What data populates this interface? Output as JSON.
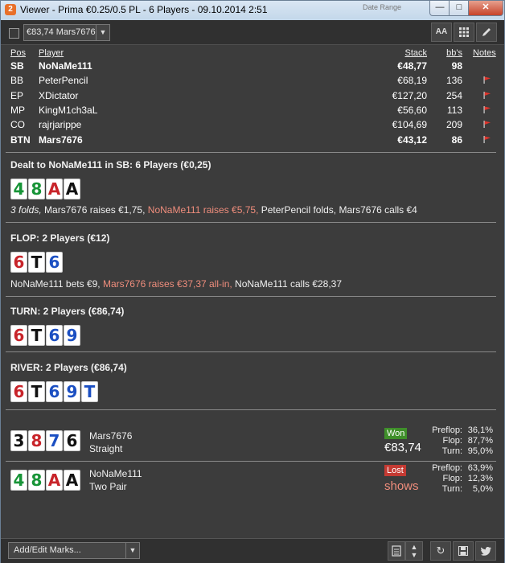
{
  "window": {
    "title": "Viewer - Prima €0.25/0.5 PL - 6 Players - 09.10.2014 2:51",
    "background_tab_text": "Date Range"
  },
  "toolbar": {
    "hand_selector_value": "€83,74 Mars7676",
    "font_button_label": "AA"
  },
  "players": {
    "headers": {
      "pos": "Pos",
      "player": "Player",
      "stack": "Stack",
      "bbs": "bb's",
      "notes": "Notes"
    },
    "rows": [
      {
        "pos": "SB",
        "name": "NoNaMe111",
        "stack": "€48,77",
        "bbs": "98",
        "flag": false,
        "bold": true
      },
      {
        "pos": "BB",
        "name": "PeterPencil",
        "stack": "€68,19",
        "bbs": "136",
        "flag": true,
        "bold": false
      },
      {
        "pos": "EP",
        "name": "XDictator",
        "stack": "€127,20",
        "bbs": "254",
        "flag": true,
        "bold": false
      },
      {
        "pos": "MP",
        "name": "KingM1ch3aL",
        "stack": "€56,60",
        "bbs": "113",
        "flag": true,
        "bold": false
      },
      {
        "pos": "CO",
        "name": "rajrjarippe",
        "stack": "€104,69",
        "bbs": "209",
        "flag": true,
        "bold": false
      },
      {
        "pos": "BTN",
        "name": "Mars7676",
        "stack": "€43,12",
        "bbs": "86",
        "flag": true,
        "bold": true
      }
    ],
    "flag_color": "#e0342b"
  },
  "preflop": {
    "title": "Dealt to NoNaMe111 in SB: 6 Players (€0,25)",
    "cards": [
      {
        "r": "4",
        "s": "c"
      },
      {
        "r": "8",
        "s": "c"
      },
      {
        "r": "A",
        "s": "h"
      },
      {
        "r": "A",
        "s": "s"
      }
    ],
    "actions": {
      "a1": "3 folds,",
      "a2": " Mars7676 raises €1,75,",
      "a3": " NoNaMe111 raises €5,75,",
      "a4": " PeterPencil folds, Mars7676 calls €4"
    }
  },
  "flop": {
    "title": "FLOP: 2 Players (€12)",
    "cards": [
      {
        "r": "6",
        "s": "h"
      },
      {
        "r": "T",
        "s": "s"
      },
      {
        "r": "6",
        "s": "d"
      }
    ],
    "actions": {
      "a1": "NoNaMe111 bets €9,",
      "a2": " Mars7676 raises €37,37 all-in,",
      "a3": " NoNaMe111 calls €28,37"
    }
  },
  "turn": {
    "title": "TURN: 2 Players (€86,74)",
    "cards": [
      {
        "r": "6",
        "s": "h"
      },
      {
        "r": "T",
        "s": "s"
      },
      {
        "r": "6",
        "s": "d"
      },
      {
        "r": "9",
        "s": "d"
      }
    ]
  },
  "river": {
    "title": "RIVER: 2 Players (€86,74)",
    "cards": [
      {
        "r": "6",
        "s": "h"
      },
      {
        "r": "T",
        "s": "s"
      },
      {
        "r": "6",
        "s": "d"
      },
      {
        "r": "9",
        "s": "d"
      },
      {
        "r": "T",
        "s": "d"
      }
    ]
  },
  "showdown": [
    {
      "cards": [
        {
          "r": "3",
          "s": "s"
        },
        {
          "r": "8",
          "s": "h"
        },
        {
          "r": "7",
          "s": "d"
        },
        {
          "r": "6",
          "s": "s"
        }
      ],
      "name": "Mars7676",
      "hand": "Straight",
      "badge": "Won",
      "amount": "€83,74",
      "amount_color": "#ffffff",
      "stats": [
        {
          "label": "Preflop:",
          "value": "36,1%"
        },
        {
          "label": "Flop:",
          "value": "87,7%"
        },
        {
          "label": "Turn:",
          "value": "95,0%"
        }
      ]
    },
    {
      "cards": [
        {
          "r": "4",
          "s": "c"
        },
        {
          "r": "8",
          "s": "c"
        },
        {
          "r": "A",
          "s": "h"
        },
        {
          "r": "A",
          "s": "s"
        }
      ],
      "name": "NoNaMe111",
      "hand": "Two Pair",
      "badge": "Lost",
      "amount": "shows",
      "amount_color": "#ef8d7c",
      "stats": [
        {
          "label": "Preflop:",
          "value": "63,9%"
        },
        {
          "label": "Flop:",
          "value": "12,3%"
        },
        {
          "label": "Turn:",
          "value": "5,0%"
        }
      ]
    }
  ],
  "suit_colors": {
    "s": "#111111",
    "h": "#c8242a",
    "d": "#1b4fc2",
    "c": "#179437"
  },
  "footer": {
    "marks_label": "Add/Edit Marks..."
  }
}
